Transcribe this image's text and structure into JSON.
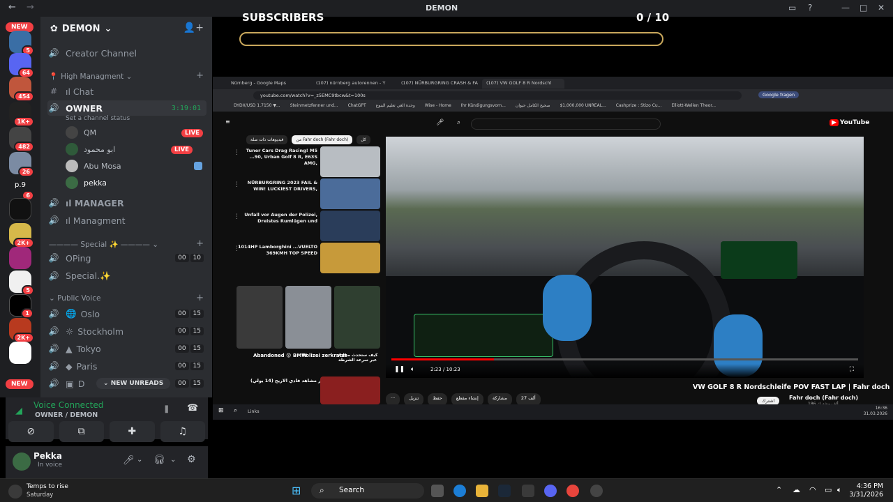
{
  "window": {
    "title": "DEMON"
  },
  "rail": {
    "new_top": "NEW",
    "new_bottom": "NEW",
    "badges": [
      "5",
      "64",
      "454",
      "1K+",
      "482",
      "26",
      "6",
      "",
      "2K+",
      "",
      "5",
      "1",
      "2K+",
      ""
    ]
  },
  "server": {
    "name": "DEMON"
  },
  "channels": {
    "creator": "Creator Channel",
    "cat_high": "High Managment",
    "chat": "ıl Chat",
    "owner": "OWNER",
    "owner_timer": "3:19:01",
    "owner_status": "Set a channel status",
    "users": [
      {
        "name": "QM",
        "live": "LIVE"
      },
      {
        "name": "ابو محمود",
        "live": "LIVE"
      },
      {
        "name": "Abu Mosa",
        "live": ""
      },
      {
        "name": "pekka",
        "live": ""
      }
    ],
    "manager": "ıl MANAGER",
    "managment": "ıl Managment",
    "cat_special": "———— Special ✨ ————",
    "oping": "OPing",
    "oping_count": [
      "00",
      "10"
    ],
    "special": "Special.✨",
    "cat_public": "Public Voice",
    "publics": [
      {
        "name": "Oslo",
        "count": [
          "00",
          "15"
        ]
      },
      {
        "name": "Stockholm",
        "count": [
          "00",
          "15"
        ]
      },
      {
        "name": "Tokyo",
        "count": [
          "00",
          "15"
        ]
      },
      {
        "name": "Paris",
        "count": [
          "00",
          "15"
        ]
      },
      {
        "name": "D",
        "count": [
          "00",
          "15"
        ]
      }
    ],
    "new_unreads": "NEW UNREADS"
  },
  "voice": {
    "title": "Voice Connected",
    "sub": "OWNER / DEMON"
  },
  "user": {
    "name": "Pekka",
    "status": "In voice"
  },
  "overlay": {
    "label": "SUBSCRIBERS",
    "count": "0 / 10",
    "progress": 0
  },
  "browser": {
    "tabs": [
      "Nürnberg - Google Maps",
      "(107) nürnberg autorennen - Y",
      "(107) NÜRBURGRING CRASH & FA",
      "(107) VW GOLF 8 R Nordschl"
    ],
    "url": "youtube.com/watch?v=_z5EMC9tbcw&t=100s",
    "bookmarks": [
      "DYDX/USD 1.7150 ▼...",
      "Steinmetzfenner und...",
      "ChatGPT",
      "وحدة الغي تعليم البنوع",
      "Wise - Home",
      "Ihr Kündigungsvorn...",
      "صحيح الكامل حيوان",
      "لحة تعلم الحساب البنين",
      "$1,000,000 UNREAL...",
      "Cashprize : Stizo Cu...",
      "الاحبس الكامل (1)",
      "Elliott-Wellen Theor...",
      "Alle Lesezeichen"
    ],
    "google_btn": "Google fragen"
  },
  "youtube": {
    "logo": "YouTube",
    "chips": [
      "كل",
      "من Fahr doch (Fahr doch)",
      "فيديوهات ذات صلة"
    ],
    "videos": [
      {
        "title": "Tuner Cars Drag Racing! M5 ...90, Urban Golf 8 R, E63S AMG,",
        "dur": "19:35"
      },
      {
        "title": "NÜRBURGRING 2023 FAIL & WIN! LUCKIEST DRIVERS,",
        "dur": "23:00"
      },
      {
        "title": "Unfall vor Augen der Polizei, Dreistes Rumlügen und",
        "dur": "12:12"
      },
      {
        "title": "1014HP Lamborghini ...VUELTO 369KMH TOP SPEED",
        "dur": "19:43"
      }
    ],
    "shorts": [
      "Abandoned 😲 BMW",
      "Polizei zerkratzt",
      "كيف ستحدث مجادة عبر سرعة الشرطة"
    ],
    "last_video": "آخر مشاهد فادي الاريح (14 يولي)",
    "player_time": "2:23 / 10:23",
    "video_title": "VW GOLF 8 R Nordschleife POV FAST LAP | Fahr doch",
    "channel": "Fahr doch (Fahr doch)",
    "channel_subs": "‎186 ألف مشترك",
    "subscribe": "اشترك",
    "actions": [
      "27 ألف",
      "مشاركة",
      "إنشاء مقطع",
      "حفظ",
      "تنزيل"
    ]
  },
  "stream_taskbar": {
    "links": "Links",
    "time": "16:36",
    "date": "31.03.2026"
  },
  "taskbar": {
    "weather_title": "Temps to rise",
    "weather_sub": "Saturday",
    "search": "Search",
    "time": "4:36 PM",
    "date": "3/31/2026"
  },
  "colors": {
    "accent_green": "#23a55a",
    "live_red": "#f23f43",
    "bar_gold": "#c9a85c"
  }
}
